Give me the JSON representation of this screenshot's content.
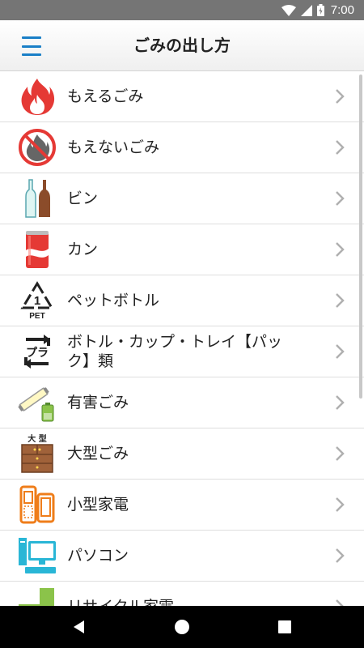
{
  "status_bar": {
    "time": "7:00",
    "icons": [
      "wifi-icon",
      "signal-icon",
      "battery-icon"
    ]
  },
  "app_bar": {
    "title": "ごみの出し方",
    "menu_icon": "hamburger-menu-icon",
    "accent": "#1a7fc7"
  },
  "categories": [
    {
      "label": "もえるごみ",
      "icon": "fire-icon"
    },
    {
      "label": "もえないごみ",
      "icon": "no-fire-icon"
    },
    {
      "label": "ビン",
      "icon": "bottles-icon"
    },
    {
      "label": "カン",
      "icon": "can-icon"
    },
    {
      "label": "ペットボトル",
      "icon": "pet-recycle-icon"
    },
    {
      "label": "ボトル・カップ・トレイ【パック】類",
      "icon": "plastic-recycle-icon"
    },
    {
      "label": "有害ごみ",
      "icon": "fluorescent-battery-icon"
    },
    {
      "label": "大型ごみ",
      "icon": "furniture-icon",
      "icon_text": "大 型"
    },
    {
      "label": "小型家電",
      "icon": "phone-tablet-icon"
    },
    {
      "label": "パソコン",
      "icon": "computer-icon"
    },
    {
      "label": "リサイクル家電",
      "icon": "appliance-icon"
    }
  ],
  "pet_icon_text": {
    "number": "1",
    "caption": "PET"
  },
  "plastic_icon_text": "プラ"
}
